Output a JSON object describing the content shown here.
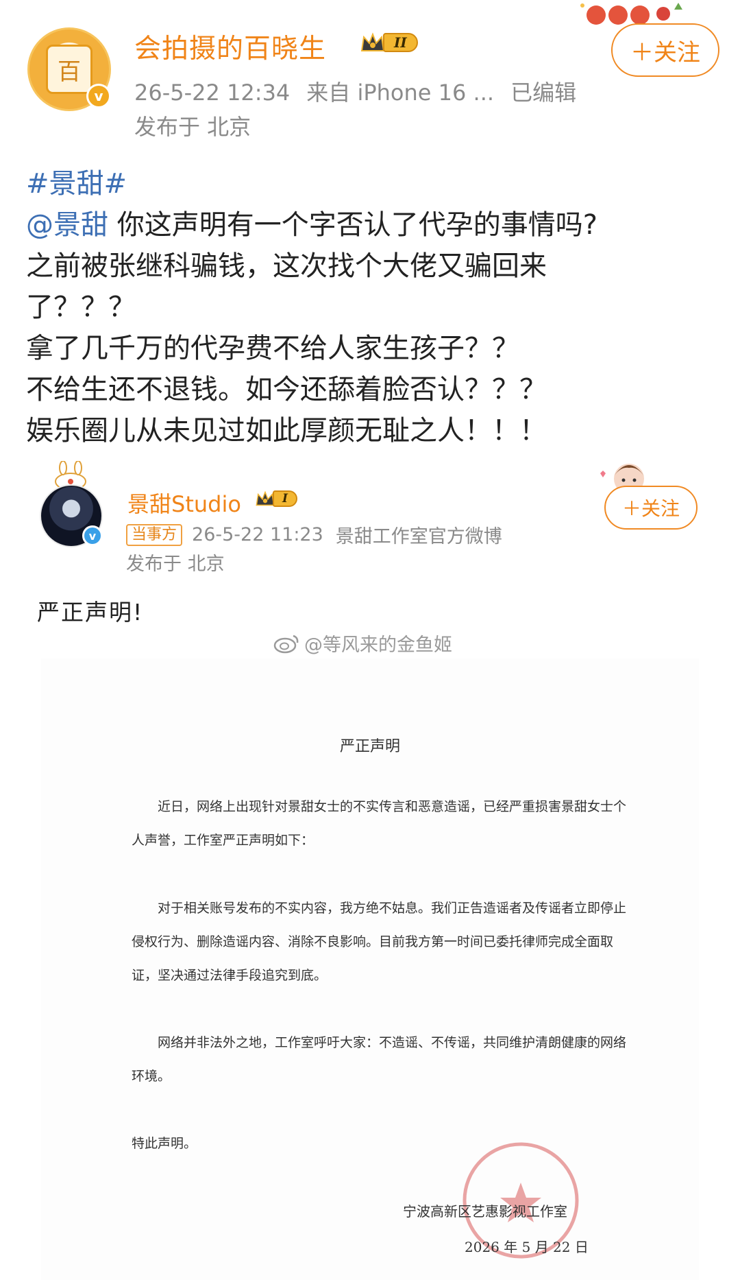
{
  "post": {
    "author": {
      "name": "会拍摄的百晓生",
      "avatar_text": "百",
      "level": "II"
    },
    "meta": {
      "time": "26-5-22 12:34",
      "source": "来自 iPhone 16 ...",
      "edited": "已编辑",
      "location": "发布于 北京"
    },
    "follow_label": "＋关注",
    "body": {
      "hashtag": "#景甜#",
      "mention": "@景甜",
      "line1_rest": " 你这声明有一个字否认了代孕的事情吗?",
      "line2": "之前被张继科骗钱，这次找个大佬又骗回来",
      "line3": "了？？？",
      "line4": "拿了几千万的代孕费不给人家生孩子？？",
      "line5": "不给生还不退钱。如今还舔着脸否认？？？",
      "line6": "娱乐圈儿从未见过如此厚颜无耻之人！！！"
    }
  },
  "embedded": {
    "author": {
      "name": "景甜Studio",
      "level": "I"
    },
    "tag": "当事方",
    "meta": {
      "time": "26-5-22 11:23",
      "source": "景甜工作室官方微博",
      "location": "发布于 北京"
    },
    "follow_label": "＋关注",
    "intro": "严正声明!",
    "watermark": "@等风来的金鱼姬",
    "document": {
      "title": "严正声明",
      "p1": "近日，网络上出现针对景甜女士的不实传言和恶意造谣，已经严重损害景甜女士个人声誉，工作室严正声明如下：",
      "p2": "对于相关账号发布的不实内容，我方绝不姑息。我们正告造谣者及传谣者立即停止侵权行为、删除造谣内容、消除不良影响。目前我方第一时间已委托律师完成全面取证，坚决通过法律手段追究到底。",
      "p3": "网络并非法外之地，工作室呼吁大家：不造谣、不传谣，共同维护清朗健康的网络环境。",
      "p4": "特此声明。",
      "signature": "宁波高新区艺惠影视工作室",
      "date": "2026 年 5 月 22 日",
      "seal_text": "宁波高新区艺惠影视工作室"
    }
  },
  "colors": {
    "accent": "#f08418",
    "link": "#3d6fb4",
    "meta": "#8a8a8a"
  },
  "icons": [
    "verified-badge-icon",
    "crown-icon",
    "weibo-logo-icon",
    "bunny-decoration-icon",
    "girl-sticker-icon"
  ]
}
